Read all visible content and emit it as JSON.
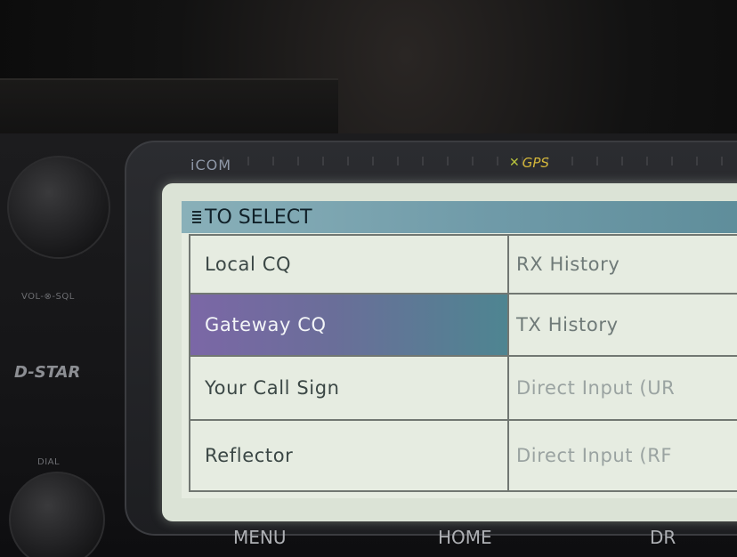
{
  "brand": "iCOM",
  "gps_label": "GPS",
  "panel_labels": {
    "vol_sql": "VOL-⊗-SQL",
    "dstar": "D-STAR",
    "dial": "DIAL"
  },
  "screen": {
    "title": "TO SELECT",
    "left_items": [
      {
        "label": "Local CQ",
        "selected": false
      },
      {
        "label": "Gateway CQ",
        "selected": true
      },
      {
        "label": "Your Call Sign",
        "selected": false
      },
      {
        "label": "Reflector",
        "selected": false
      }
    ],
    "right_items": [
      {
        "label": "RX History"
      },
      {
        "label": "TX History"
      },
      {
        "label": "Direct Input (UR"
      },
      {
        "label": "Direct Input (RF"
      }
    ]
  },
  "hardware_buttons": {
    "menu": "MENU",
    "home": "HOME",
    "dr": "DR"
  },
  "icons": {
    "menu": "menu-lines-icon",
    "gps": "gps-satellite-icon"
  },
  "colors": {
    "title_bar": "#6f9aa8",
    "selected_row": "#7b67a6",
    "lcd_background": "#e6ece1"
  }
}
